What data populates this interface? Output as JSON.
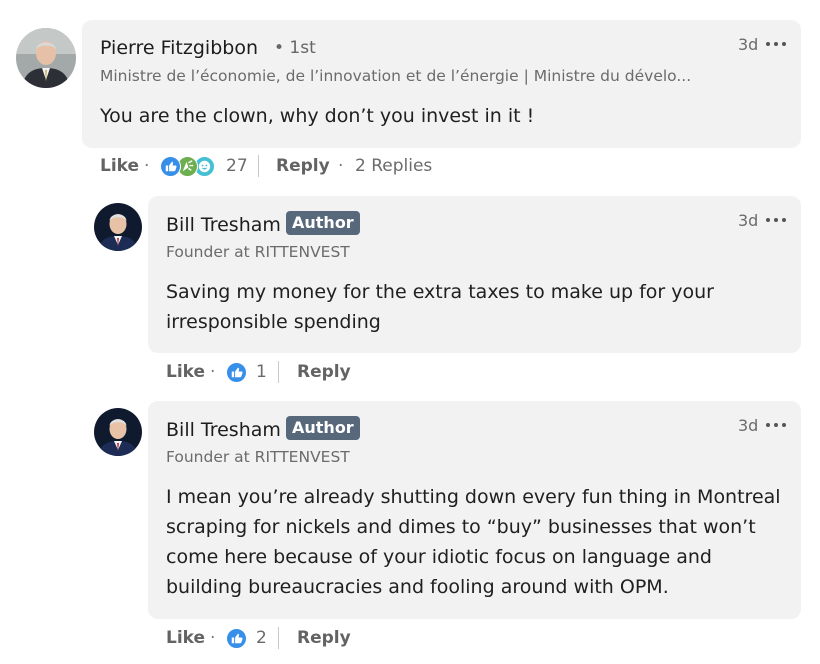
{
  "comments": [
    {
      "author": "Pierre Fitzgibbon",
      "degree": "• 1st",
      "headline": "Ministre de l’économie, de l’innovation et de l’énergie | Ministre du dévelo...",
      "time": "3d",
      "text": "You are the clown, why don’t you invest in it !",
      "like_label": "Like",
      "reaction_count": "27",
      "reply_label": "Reply",
      "replies_label": "2 Replies",
      "reactions": [
        "like-reaction-icon",
        "celebrate-reaction-icon",
        "funny-reaction-icon"
      ]
    },
    {
      "author": "Bill Tresham",
      "badge": "Author",
      "headline": "Founder at RITTENVEST",
      "time": "3d",
      "text_lines": [
        "Saving my money for the extra taxes to make up for your",
        "irresponsible spending"
      ],
      "like_label": "Like",
      "reaction_count": "1",
      "reply_label": "Reply",
      "reactions": [
        "like-reaction-icon"
      ]
    },
    {
      "author": "Bill Tresham",
      "badge": "Author",
      "headline": "Founder at RITTENVEST",
      "time": "3d",
      "text_lines": [
        "I mean you’re already shutting down every fun thing in Montreal",
        "scraping for nickels and dimes to “buy” businesses that won’t",
        "come here because of your idiotic focus on language and",
        "building bureaucracies and fooling around with OPM."
      ],
      "like_label": "Like",
      "reaction_count": "2",
      "reply_label": "Reply",
      "reactions": [
        "like-reaction-icon"
      ]
    }
  ],
  "colors": {
    "bubble": "#f2f2f2",
    "badge": "#56687a",
    "like_blue": "#378fe9",
    "celebrate_green": "#6dae4f",
    "funny_teal": "#44bfd3"
  }
}
